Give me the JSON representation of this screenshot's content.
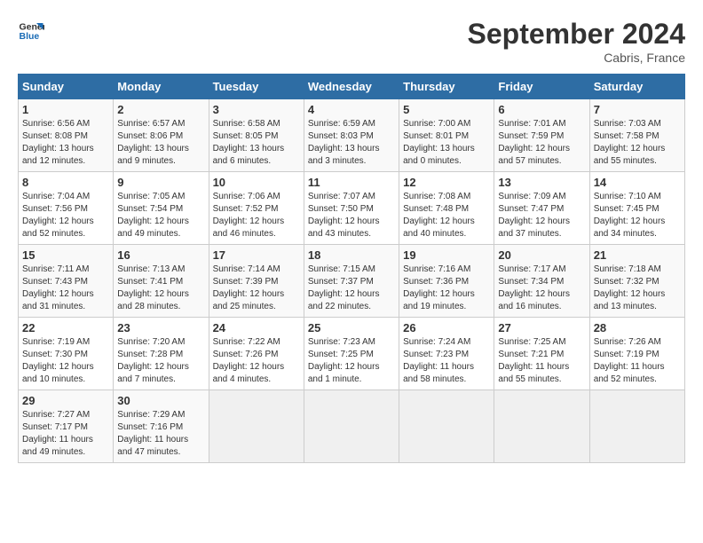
{
  "logo": {
    "line1": "General",
    "line2": "Blue"
  },
  "title": "September 2024",
  "location": "Cabris, France",
  "days_of_week": [
    "Sunday",
    "Monday",
    "Tuesday",
    "Wednesday",
    "Thursday",
    "Friday",
    "Saturday"
  ],
  "weeks": [
    [
      {
        "num": "1",
        "sunrise": "6:56 AM",
        "sunset": "8:08 PM",
        "daylight": "13 hours and 12 minutes."
      },
      {
        "num": "2",
        "sunrise": "6:57 AM",
        "sunset": "8:06 PM",
        "daylight": "13 hours and 9 minutes."
      },
      {
        "num": "3",
        "sunrise": "6:58 AM",
        "sunset": "8:05 PM",
        "daylight": "13 hours and 6 minutes."
      },
      {
        "num": "4",
        "sunrise": "6:59 AM",
        "sunset": "8:03 PM",
        "daylight": "13 hours and 3 minutes."
      },
      {
        "num": "5",
        "sunrise": "7:00 AM",
        "sunset": "8:01 PM",
        "daylight": "13 hours and 0 minutes."
      },
      {
        "num": "6",
        "sunrise": "7:01 AM",
        "sunset": "7:59 PM",
        "daylight": "12 hours and 57 minutes."
      },
      {
        "num": "7",
        "sunrise": "7:03 AM",
        "sunset": "7:58 PM",
        "daylight": "12 hours and 55 minutes."
      }
    ],
    [
      {
        "num": "8",
        "sunrise": "7:04 AM",
        "sunset": "7:56 PM",
        "daylight": "12 hours and 52 minutes."
      },
      {
        "num": "9",
        "sunrise": "7:05 AM",
        "sunset": "7:54 PM",
        "daylight": "12 hours and 49 minutes."
      },
      {
        "num": "10",
        "sunrise": "7:06 AM",
        "sunset": "7:52 PM",
        "daylight": "12 hours and 46 minutes."
      },
      {
        "num": "11",
        "sunrise": "7:07 AM",
        "sunset": "7:50 PM",
        "daylight": "12 hours and 43 minutes."
      },
      {
        "num": "12",
        "sunrise": "7:08 AM",
        "sunset": "7:48 PM",
        "daylight": "12 hours and 40 minutes."
      },
      {
        "num": "13",
        "sunrise": "7:09 AM",
        "sunset": "7:47 PM",
        "daylight": "12 hours and 37 minutes."
      },
      {
        "num": "14",
        "sunrise": "7:10 AM",
        "sunset": "7:45 PM",
        "daylight": "12 hours and 34 minutes."
      }
    ],
    [
      {
        "num": "15",
        "sunrise": "7:11 AM",
        "sunset": "7:43 PM",
        "daylight": "12 hours and 31 minutes."
      },
      {
        "num": "16",
        "sunrise": "7:13 AM",
        "sunset": "7:41 PM",
        "daylight": "12 hours and 28 minutes."
      },
      {
        "num": "17",
        "sunrise": "7:14 AM",
        "sunset": "7:39 PM",
        "daylight": "12 hours and 25 minutes."
      },
      {
        "num": "18",
        "sunrise": "7:15 AM",
        "sunset": "7:37 PM",
        "daylight": "12 hours and 22 minutes."
      },
      {
        "num": "19",
        "sunrise": "7:16 AM",
        "sunset": "7:36 PM",
        "daylight": "12 hours and 19 minutes."
      },
      {
        "num": "20",
        "sunrise": "7:17 AM",
        "sunset": "7:34 PM",
        "daylight": "12 hours and 16 minutes."
      },
      {
        "num": "21",
        "sunrise": "7:18 AM",
        "sunset": "7:32 PM",
        "daylight": "12 hours and 13 minutes."
      }
    ],
    [
      {
        "num": "22",
        "sunrise": "7:19 AM",
        "sunset": "7:30 PM",
        "daylight": "12 hours and 10 minutes."
      },
      {
        "num": "23",
        "sunrise": "7:20 AM",
        "sunset": "7:28 PM",
        "daylight": "12 hours and 7 minutes."
      },
      {
        "num": "24",
        "sunrise": "7:22 AM",
        "sunset": "7:26 PM",
        "daylight": "12 hours and 4 minutes."
      },
      {
        "num": "25",
        "sunrise": "7:23 AM",
        "sunset": "7:25 PM",
        "daylight": "12 hours and 1 minute."
      },
      {
        "num": "26",
        "sunrise": "7:24 AM",
        "sunset": "7:23 PM",
        "daylight": "11 hours and 58 minutes."
      },
      {
        "num": "27",
        "sunrise": "7:25 AM",
        "sunset": "7:21 PM",
        "daylight": "11 hours and 55 minutes."
      },
      {
        "num": "28",
        "sunrise": "7:26 AM",
        "sunset": "7:19 PM",
        "daylight": "11 hours and 52 minutes."
      }
    ],
    [
      {
        "num": "29",
        "sunrise": "7:27 AM",
        "sunset": "7:17 PM",
        "daylight": "11 hours and 49 minutes."
      },
      {
        "num": "30",
        "sunrise": "7:29 AM",
        "sunset": "7:16 PM",
        "daylight": "11 hours and 47 minutes."
      },
      null,
      null,
      null,
      null,
      null
    ]
  ]
}
